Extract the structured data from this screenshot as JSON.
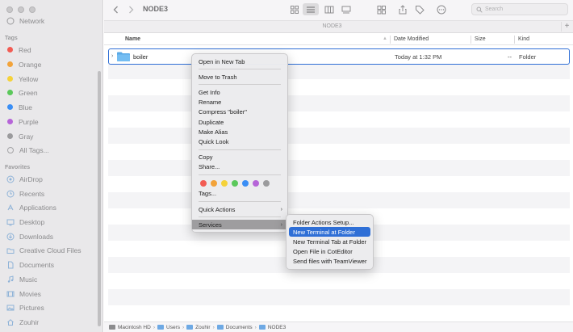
{
  "sidebar": {
    "network_label": "Network",
    "tags_header": "Tags",
    "tags": [
      {
        "label": "Red",
        "color": "#f25c54"
      },
      {
        "label": "Orange",
        "color": "#f2a33a"
      },
      {
        "label": "Yellow",
        "color": "#f5d23a"
      },
      {
        "label": "Green",
        "color": "#5bc85b"
      },
      {
        "label": "Blue",
        "color": "#3a8ef5"
      },
      {
        "label": "Purple",
        "color": "#b665d8"
      },
      {
        "label": "Gray",
        "color": "#9b9b9d"
      },
      {
        "label": "All Tags..."
      }
    ],
    "favorites_header": "Favorites",
    "favorites": [
      {
        "label": "AirDrop",
        "icon": "airdrop-icon"
      },
      {
        "label": "Recents",
        "icon": "clock-icon"
      },
      {
        "label": "Applications",
        "icon": "applications-icon"
      },
      {
        "label": "Desktop",
        "icon": "desktop-icon"
      },
      {
        "label": "Downloads",
        "icon": "downloads-icon"
      },
      {
        "label": "Creative Cloud Files",
        "icon": "folder-icon"
      },
      {
        "label": "Documents",
        "icon": "document-icon"
      },
      {
        "label": "Music",
        "icon": "music-icon"
      },
      {
        "label": "Movies",
        "icon": "movies-icon"
      },
      {
        "label": "Pictures",
        "icon": "pictures-icon"
      },
      {
        "label": "Zouhir",
        "icon": "home-icon"
      }
    ]
  },
  "toolbar": {
    "title": "NODE3",
    "search_placeholder": "Search"
  },
  "tabbar": {
    "label": "NODE3"
  },
  "columns": {
    "name": "Name",
    "date": "Date Modified",
    "size": "Size",
    "kind": "Kind"
  },
  "file": {
    "name": "boiler",
    "date": "Today at 1:32 PM",
    "size": "--",
    "kind": "Folder"
  },
  "context_menu": {
    "open_new_tab": "Open in New Tab",
    "move_trash": "Move to Trash",
    "get_info": "Get Info",
    "rename": "Rename",
    "compress": "Compress \"boiler\"",
    "duplicate": "Duplicate",
    "make_alias": "Make Alias",
    "quick_look": "Quick Look",
    "copy": "Copy",
    "share": "Share...",
    "tag_colors": [
      "#f25c54",
      "#f2a33a",
      "#f5d23a",
      "#5bc85b",
      "#3a8ef5",
      "#b665d8",
      "#9b9b9d"
    ],
    "tags": "Tags...",
    "quick_actions": "Quick Actions",
    "services": "Services"
  },
  "services_menu": {
    "folder_actions": "Folder Actions Setup...",
    "new_terminal": "New Terminal at Folder",
    "new_terminal_tab": "New Terminal Tab at Folder",
    "open_coteditor": "Open File in CotEditor",
    "send_teamviewer": "Send files with TeamViewer"
  },
  "pathbar": {
    "items": [
      "Macintosh HD",
      "Users",
      "Zouhir",
      "Documents",
      "NODE3"
    ],
    "separator": "›"
  }
}
